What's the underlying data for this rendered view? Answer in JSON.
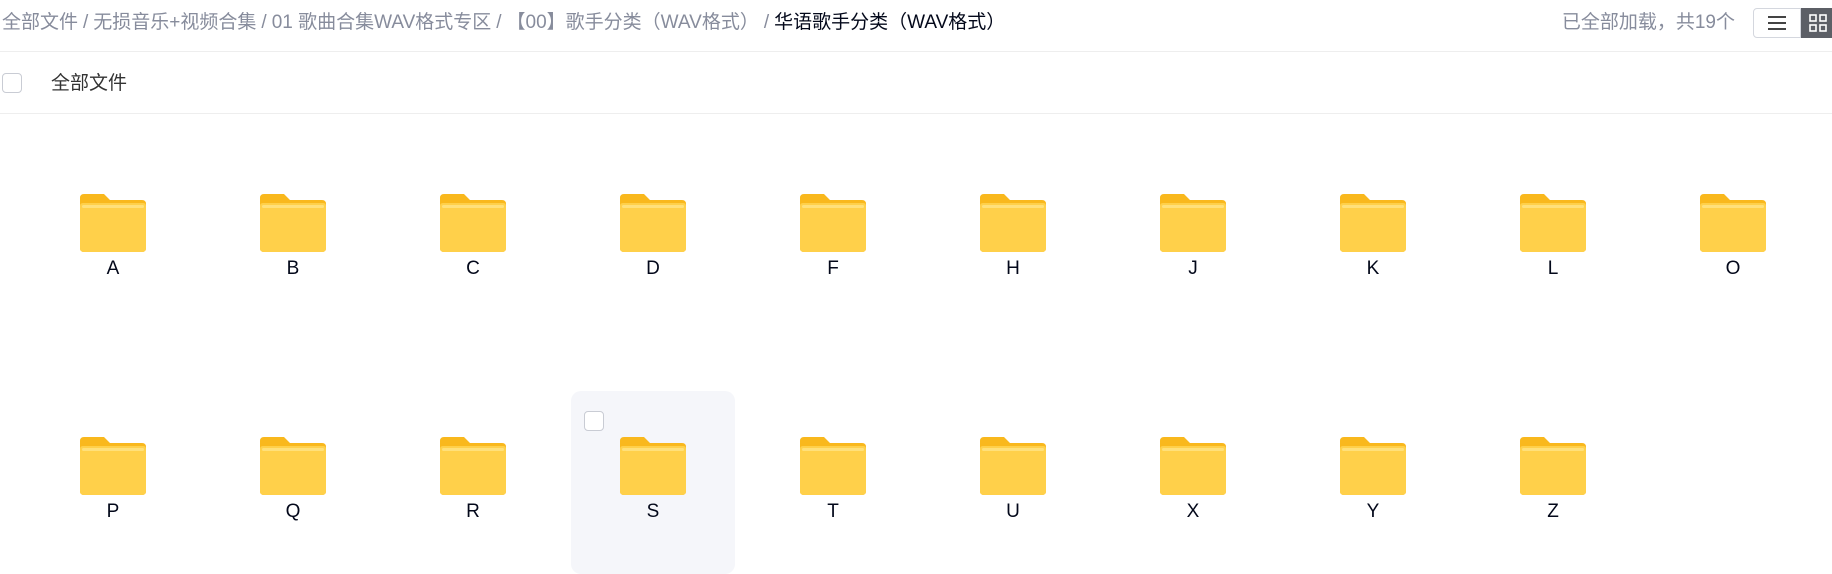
{
  "breadcrumb": {
    "items": [
      "全部文件",
      "无损音乐+视频合集",
      "01 歌曲合集WAV格式专区",
      "【00】歌手分类（WAV格式）",
      "华语歌手分类（WAV格式）"
    ],
    "separator": "/"
  },
  "status": {
    "loaded_text": "已全部加载，共19个"
  },
  "view_toggle": {
    "list_icon": "list-icon",
    "grid_icon": "grid-icon",
    "active": "grid"
  },
  "list_header": {
    "select_all_label": "全部文件"
  },
  "folders": [
    "A",
    "B",
    "C",
    "D",
    "F",
    "H",
    "J",
    "K",
    "L",
    "O",
    "P",
    "Q",
    "R",
    "S",
    "T",
    "U",
    "X",
    "Y",
    "Z"
  ],
  "hovered_folder": "S",
  "colors": {
    "folder_back": "#f9b81d",
    "folder_front": "#ffd04a",
    "hover_bg": "#f5f6fa",
    "text_muted": "#878c9c",
    "text_primary": "#03081a"
  }
}
